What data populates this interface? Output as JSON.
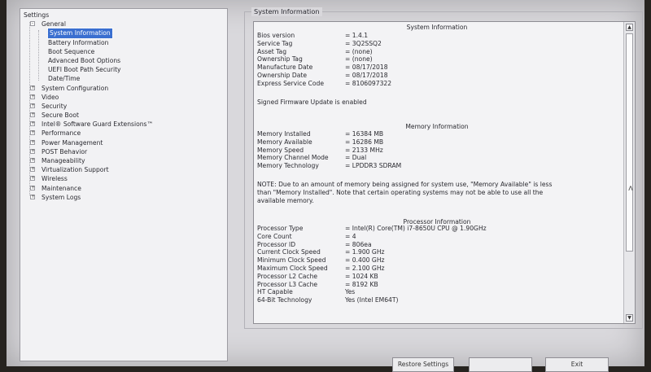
{
  "tree": {
    "root_label": "Settings",
    "items": [
      {
        "label": "General",
        "level": 1,
        "expander": "-"
      },
      {
        "label": "System Information",
        "level": 2,
        "selected": true
      },
      {
        "label": "Battery Information",
        "level": 2
      },
      {
        "label": "Boot Sequence",
        "level": 2
      },
      {
        "label": "Advanced Boot Options",
        "level": 2
      },
      {
        "label": "UEFI Boot Path Security",
        "level": 2
      },
      {
        "label": "Date/Time",
        "level": 2
      },
      {
        "label": "System Configuration",
        "level": 1,
        "expander": "+"
      },
      {
        "label": "Video",
        "level": 1,
        "expander": "+"
      },
      {
        "label": "Security",
        "level": 1,
        "expander": "+"
      },
      {
        "label": "Secure Boot",
        "level": 1,
        "expander": "+"
      },
      {
        "label": "Intel® Software Guard Extensions™",
        "level": 1,
        "expander": "+"
      },
      {
        "label": "Performance",
        "level": 1,
        "expander": "+"
      },
      {
        "label": "Power Management",
        "level": 1,
        "expander": "+"
      },
      {
        "label": "POST Behavior",
        "level": 1,
        "expander": "+"
      },
      {
        "label": "Manageability",
        "level": 1,
        "expander": "+"
      },
      {
        "label": "Virtualization Support",
        "level": 1,
        "expander": "+"
      },
      {
        "label": "Wireless",
        "level": 1,
        "expander": "+"
      },
      {
        "label": "Maintenance",
        "level": 1,
        "expander": "+"
      },
      {
        "label": "System Logs",
        "level": 1,
        "expander": "+"
      }
    ]
  },
  "group_title": "System Information",
  "info": {
    "sys_title": "System Information",
    "sys_rows": [
      {
        "k": "Bios version",
        "v": "= 1.4.1"
      },
      {
        "k": "Service Tag",
        "v": "= 3Q2SSQ2"
      },
      {
        "k": "Asset Tag",
        "v": "= (none)"
      },
      {
        "k": "Ownership Tag",
        "v": "= (none)"
      },
      {
        "k": "Manufacture Date",
        "v": "= 08/17/2018"
      },
      {
        "k": "Ownership Date",
        "v": "= 08/17/2018"
      },
      {
        "k": "Express Service Code",
        "v": "= 8106097322"
      }
    ],
    "firmware_note": "Signed Firmware Update is enabled",
    "mem_title": "Memory Information",
    "mem_rows": [
      {
        "k": "Memory Installed",
        "v": "= 16384 MB"
      },
      {
        "k": "Memory Available",
        "v": "= 16286 MB"
      },
      {
        "k": "Memory Speed",
        "v": "= 2133 MHz"
      },
      {
        "k": "Memory Channel Mode",
        "v": "= Dual"
      },
      {
        "k": "Memory Technology",
        "v": "= LPDDR3 SDRAM"
      }
    ],
    "mem_note_lines": [
      "NOTE: Due to an amount of memory being assigned for system use, \"Memory Available\" is less",
      "than \"Memory Installed\". Note that certain operating systems may not be able to use all the",
      "available memory."
    ],
    "proc_title": "Processor Information",
    "proc_rows": [
      {
        "k": "Processor Type",
        "v": "= Intel(R) Core(TM) i7-8650U CPU @ 1.90GHz"
      },
      {
        "k": "Core Count",
        "v": "= 4"
      },
      {
        "k": "Processor ID",
        "v": "= 806ea"
      },
      {
        "k": "Current Clock Speed",
        "v": "= 1.900 GHz"
      },
      {
        "k": "Minimum Clock Speed",
        "v": "= 0.400 GHz"
      },
      {
        "k": "Maximum Clock Speed",
        "v": "= 2.100 GHz"
      },
      {
        "k": "Processor L2 Cache",
        "v": "= 1024 KB"
      },
      {
        "k": "Processor L3 Cache",
        "v": "= 8192 KB"
      },
      {
        "k": "HT Capable",
        "v": "Yes"
      },
      {
        "k": "64-Bit Technology",
        "v": "Yes (Intel EM64T)"
      }
    ]
  },
  "scroll": {
    "up": "▲",
    "down": "▼"
  },
  "buttons": {
    "restore": "Restore Settings",
    "apply": "",
    "exit": "Exit"
  }
}
